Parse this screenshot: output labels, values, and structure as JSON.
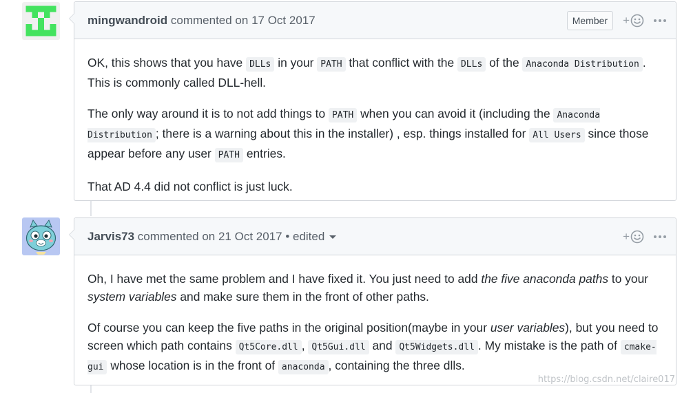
{
  "comments": [
    {
      "author": "mingwandroid",
      "meta": " commented on 17 Oct 2017",
      "badge": "Member",
      "p1": {
        "a": "OK, this shows that you have ",
        "c1": "DLLs",
        "b": " in your ",
        "c2": "PATH",
        "c": " that conflict with the ",
        "c3": "DLLs",
        "d": " of the ",
        "c4": "Anaconda Distribution",
        "e": ". This is commonly called DLL-hell."
      },
      "p2": {
        "a": "The only way around it is to not add things to ",
        "c1": "PATH",
        "b": " when you can avoid it (including the ",
        "c2": "Anaconda Distribution",
        "c": "; there is a warning about this in the installer) , esp. things installed for ",
        "c3": "All Users",
        "d": " since those appear before any user ",
        "c4": "PATH",
        "e": " entries."
      },
      "p3": "That AD 4.4 did not conflict is just luck."
    },
    {
      "author": "Jarvis73",
      "meta": " commented on 21 Oct 2017 • edited",
      "p1": {
        "a": "Oh, I have met the same problem and I have fixed it. You just need to add ",
        "em1": "the five anaconda paths",
        "b": " to your ",
        "em2": "system variables",
        "c": " and make sure them in the front of other paths."
      },
      "p2": {
        "a": "Of course you can keep the five paths in the original position(maybe in your ",
        "em1": "user variables",
        "b": "), but you need to screen which path contains ",
        "c1": "Qt5Core.dll",
        "c": ", ",
        "c2": "Qt5Gui.dll",
        "d": " and ",
        "c3": "Qt5Widgets.dll",
        "e": ". My mistake is the path of ",
        "c4": "cmake-gui",
        "f": " whose location is in the front of ",
        "c5": "anaconda",
        "g": ", containing the three dlls."
      }
    }
  ],
  "watermark": "https://blog.csdn.net/claire017",
  "icons": {
    "reaction": "smiley-add-icon",
    "more": "kebab-menu-icon",
    "dropdown": "caret-down-icon"
  },
  "colors": {
    "header_bg": "#f6f8fa",
    "border": "#d1d5da",
    "code_bg": "#eff1f3",
    "identicon": "#44e35f",
    "avatar2_bg": "#b8c7f2"
  }
}
